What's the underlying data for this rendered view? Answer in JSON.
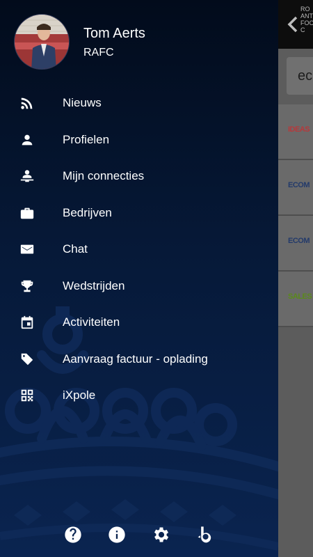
{
  "profile": {
    "name": "Tom Aerts",
    "club": "RAFC"
  },
  "menu": [
    {
      "label": "Nieuws",
      "icon": "rss-icon"
    },
    {
      "label": "Profielen",
      "icon": "person-icon"
    },
    {
      "label": "Mijn connecties",
      "icon": "connections-icon"
    },
    {
      "label": "Bedrijven",
      "icon": "briefcase-icon"
    },
    {
      "label": "Chat",
      "icon": "mail-icon"
    },
    {
      "label": "Wedstrijden",
      "icon": "trophy-icon"
    },
    {
      "label": "Activiteiten",
      "icon": "calendar-icon"
    },
    {
      "label": "Aanvraag factuur - oplading",
      "icon": "tag-icon"
    },
    {
      "label": "iXpole",
      "icon": "qr-code-icon"
    }
  ],
  "background": {
    "header_text": "RO\nANTW\nFOO\nC",
    "search_text": "ec",
    "cards": [
      "IDEAS",
      "ECOM",
      "ECOM",
      "SALES"
    ]
  },
  "colors": {
    "drawer_top": "#020b1b",
    "drawer_bottom": "#0a2450",
    "text": "#ffffff"
  }
}
